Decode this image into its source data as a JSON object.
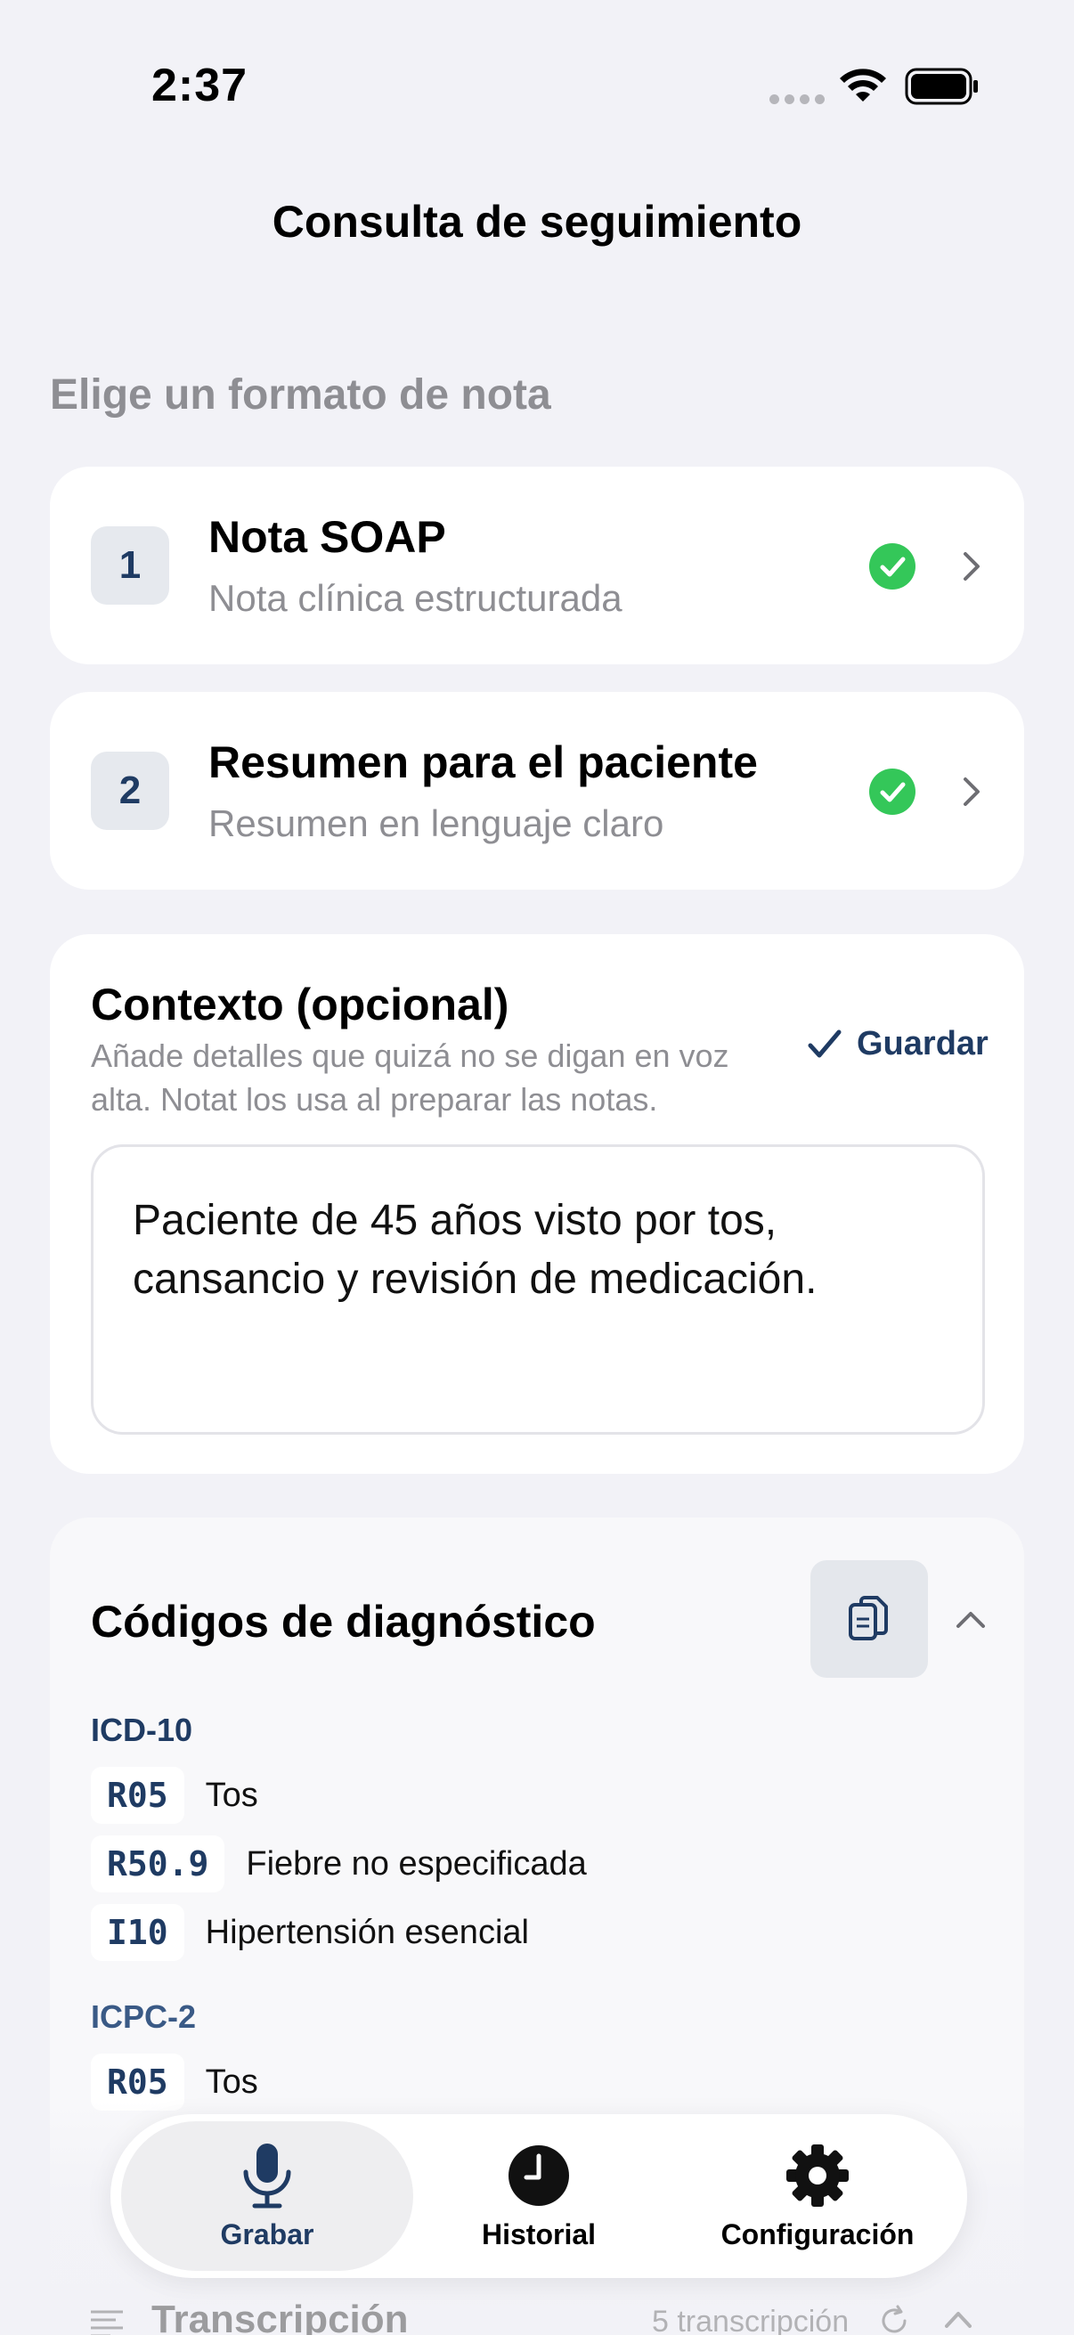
{
  "status": {
    "time": "2:37"
  },
  "nav": {
    "title": "Consulta de seguimiento"
  },
  "section_label": "Elige un formato de nota",
  "formats": [
    {
      "number": "1",
      "title": "Nota SOAP",
      "subtitle": "Nota clínica estructurada"
    },
    {
      "number": "2",
      "title": "Resumen para el paciente",
      "subtitle": "Resumen en lenguaje claro"
    }
  ],
  "context": {
    "title": "Contexto (opcional)",
    "description": "Añade detalles que quizá no se digan en voz alta. Notat los usa al preparar las notas.",
    "save_label": "Guardar",
    "value": "Paciente de 45 años visto por tos, cansancio y revisión de medicación."
  },
  "diagnosis": {
    "title": "Códigos de diagnóstico",
    "icd10_label": "ICD-10",
    "icd10": [
      {
        "code": "R05",
        "desc": "Tos"
      },
      {
        "code": "R50.9",
        "desc": "Fiebre no especificada"
      },
      {
        "code": "I10",
        "desc": "Hipertensión esencial"
      }
    ],
    "icpc2_label": "ICPC-2",
    "icpc2": [
      {
        "code": "R05",
        "desc": "Tos"
      }
    ]
  },
  "transcript": {
    "title": "Transcripción",
    "count": "5 transcripción"
  },
  "tabs": [
    {
      "label": "Grabar"
    },
    {
      "label": "Historial"
    },
    {
      "label": "Configuración"
    }
  ],
  "colors": {
    "accent": "#1f3b63",
    "success": "#34c759",
    "background": "#f2f2f7"
  }
}
